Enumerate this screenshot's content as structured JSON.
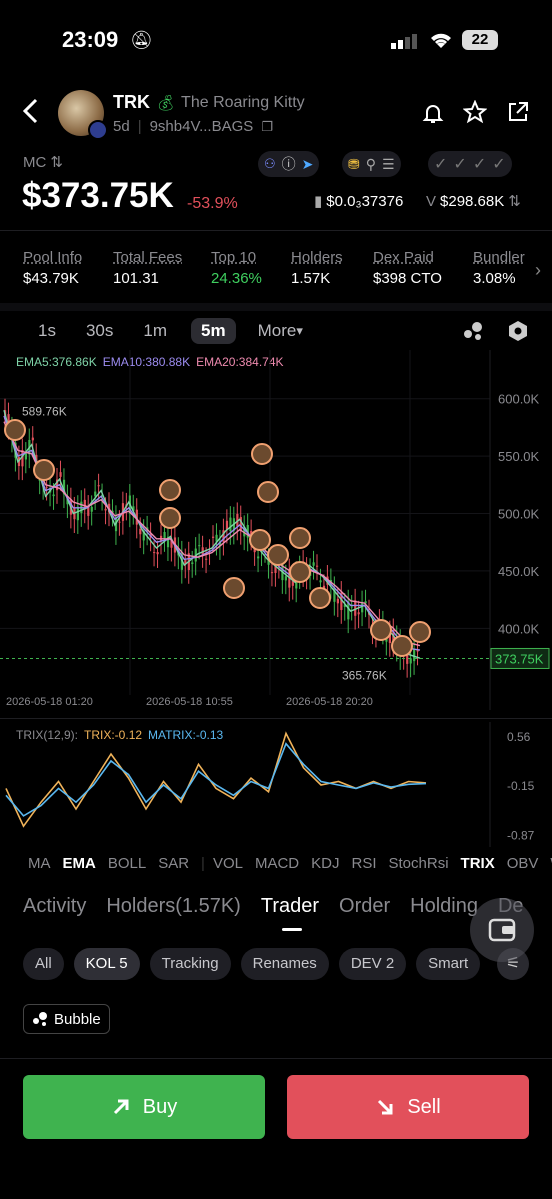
{
  "status_bar": {
    "time": "23:09",
    "battery": "22"
  },
  "token": {
    "symbol": "TRK",
    "name": "The Roaring Kitty",
    "age": "5d",
    "address": "9shb4V...BAGS",
    "mc_label": "MC",
    "market_cap": "$373.75K",
    "change": "-53.9%",
    "price": "$0.0₃37376",
    "volume_prefix": "V",
    "volume": "$298.68K"
  },
  "stats": [
    {
      "label": "Pool Info",
      "value": "$43.79K"
    },
    {
      "label": "Total Fees",
      "value": "101.31"
    },
    {
      "label": "Top 10",
      "value": "24.36%"
    },
    {
      "label": "Holders",
      "value": "1.57K"
    },
    {
      "label": "Dex Paid",
      "value": "$398 CTO"
    },
    {
      "label": "Bundler",
      "value": "3.08%"
    }
  ],
  "timeframes": [
    "1s",
    "30s",
    "1m",
    "5m",
    "More"
  ],
  "active_timeframe": "5m",
  "ema_legend": {
    "ema5": "EMA5:376.86K",
    "ema10": "EMA10:380.88K",
    "ema20": "EMA20:384.74K"
  },
  "chart_data": [
    {
      "type": "line",
      "title": "",
      "x_ticks": [
        "2026-05-18 01:20",
        "2026-05-18 10:55",
        "2026-05-18 20:20"
      ],
      "y_ticks": [
        "600.0K",
        "550.0K",
        "500.0K",
        "450.0K",
        "400.0K"
      ],
      "ylim": [
        355,
        625
      ],
      "annotations": {
        "high": "589.76K",
        "low": "365.76K",
        "last": "373.75K"
      },
      "series": [
        {
          "name": "EMA5",
          "color": "#7fd3a8",
          "values": [
            590,
            545,
            560,
            515,
            530,
            500,
            505,
            520,
            490,
            510,
            485,
            470,
            480,
            455,
            465,
            470,
            485,
            495,
            475,
            460,
            450,
            440,
            455,
            445,
            430,
            415,
            420,
            400,
            395,
            378,
            374
          ]
        },
        {
          "name": "EMA10",
          "color": "#9c8cf0",
          "values": [
            585,
            550,
            555,
            520,
            525,
            505,
            505,
            515,
            495,
            505,
            488,
            475,
            478,
            460,
            462,
            468,
            480,
            490,
            478,
            463,
            452,
            443,
            452,
            446,
            433,
            420,
            420,
            404,
            398,
            383,
            381
          ]
        },
        {
          "name": "EMA20",
          "color": "#ef8bb0",
          "values": [
            580,
            555,
            552,
            525,
            522,
            510,
            506,
            512,
            498,
            502,
            490,
            478,
            478,
            464,
            462,
            466,
            476,
            486,
            478,
            466,
            455,
            447,
            451,
            446,
            436,
            424,
            422,
            408,
            401,
            388,
            385
          ]
        }
      ]
    },
    {
      "type": "line",
      "title": "",
      "legend": {
        "label": "TRIX(12,9):",
        "trix": "TRIX:-0.12",
        "matrix": "MATRIX:-0.13"
      },
      "y_ticks": [
        "0.56",
        "-0.15",
        "-0.87"
      ],
      "ylim": [
        -0.95,
        0.62
      ],
      "series": [
        {
          "name": "TRIX",
          "color": "#f0b35a",
          "values": [
            -0.2,
            -0.75,
            -0.4,
            -0.1,
            -0.5,
            -0.1,
            0.3,
            -0.05,
            -0.5,
            -0.1,
            -0.4,
            0.15,
            -0.2,
            -0.35,
            -0.05,
            -0.25,
            0.6,
            0.1,
            -0.15,
            -0.1,
            -0.2,
            -0.1,
            -0.2,
            -0.1,
            -0.12
          ]
        },
        {
          "name": "MATRIX",
          "color": "#5ab8f0",
          "values": [
            -0.3,
            -0.6,
            -0.45,
            -0.2,
            -0.4,
            -0.15,
            0.2,
            0.0,
            -0.4,
            -0.15,
            -0.35,
            0.05,
            -0.15,
            -0.3,
            -0.1,
            -0.2,
            0.45,
            0.15,
            -0.1,
            -0.15,
            -0.2,
            -0.12,
            -0.18,
            -0.14,
            -0.13
          ]
        }
      ]
    }
  ],
  "indicators": [
    "MA",
    "EMA",
    "BOLL",
    "SAR",
    "VOL",
    "MACD",
    "KDJ",
    "RSI",
    "StochRsi",
    "TRIX",
    "OBV",
    "WR"
  ],
  "section_tabs": [
    "Activity",
    "Holders(1.57K)",
    "Trader",
    "Order",
    "Holding",
    "De"
  ],
  "active_section": "Trader",
  "filters": [
    "All",
    "KOL 5",
    "Tracking",
    "Renames",
    "DEV 2",
    "Smart"
  ],
  "active_filter": "KOL 5",
  "bubble_label": "Bubble",
  "actions": {
    "buy": "Buy",
    "sell": "Sell"
  }
}
